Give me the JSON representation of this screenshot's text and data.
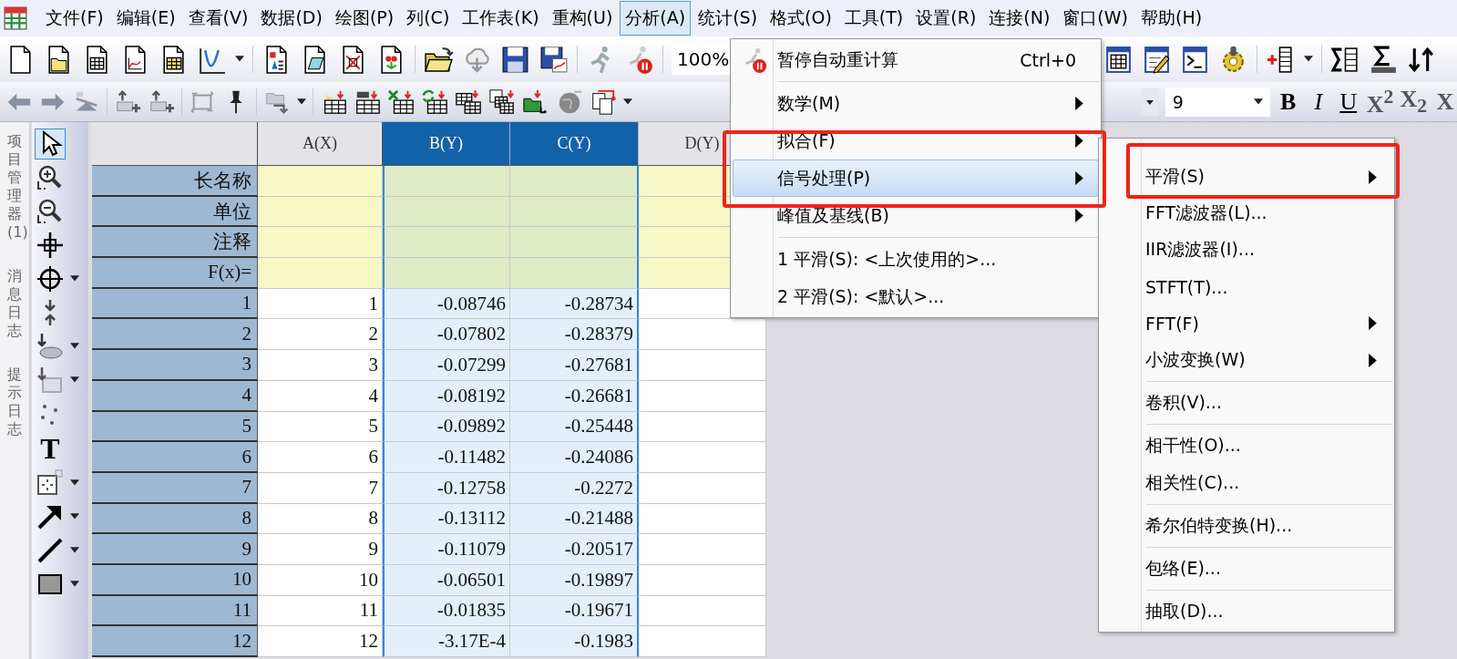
{
  "menu_bar": [
    {
      "label": "文件(F)",
      "selected": false
    },
    {
      "label": "编辑(E)",
      "selected": false
    },
    {
      "label": "查看(V)",
      "selected": false
    },
    {
      "label": "数据(D)",
      "selected": false
    },
    {
      "label": "绘图(P)",
      "selected": false
    },
    {
      "label": "列(C)",
      "selected": false
    },
    {
      "label": "工作表(K)",
      "selected": false
    },
    {
      "label": "重构(U)",
      "selected": false
    },
    {
      "label": "分析(A)",
      "selected": true
    },
    {
      "label": "统计(S)",
      "selected": false
    },
    {
      "label": "格式(O)",
      "selected": false
    },
    {
      "label": "工具(T)",
      "selected": false
    },
    {
      "label": "设置(R)",
      "selected": false
    },
    {
      "label": "连接(N)",
      "selected": false
    },
    {
      "label": "窗口(W)",
      "selected": false
    },
    {
      "label": "帮助(H)",
      "selected": false
    }
  ],
  "zoom_field": {
    "value": "100%"
  },
  "font_size_field": {
    "value": "9"
  },
  "format_buttons": [
    {
      "label": "B",
      "kind": "bold"
    },
    {
      "label": "I",
      "kind": "italic"
    },
    {
      "label": "U",
      "kind": "underline"
    },
    {
      "label": "X$^{2}$",
      "kind": "script"
    },
    {
      "label": "X$_{2}$",
      "kind": "script"
    },
    {
      "label": "X",
      "kind": "script"
    }
  ],
  "side_tabs": [
    "项目管理器(1)",
    "消息日志",
    "提示日志"
  ],
  "toolbox": {
    "pointer": {
      "selected": true
    },
    "text_tool": {
      "label": "T",
      "selected": false
    }
  },
  "worksheet": {
    "columns": [
      {
        "label": "A(X)",
        "selected": false
      },
      {
        "label": "B(Y)",
        "selected": true
      },
      {
        "label": "C(Y)",
        "selected": true
      },
      {
        "label": "D(Y)",
        "selected": false
      }
    ],
    "label_rows": [
      "长名称",
      "单位",
      "注释",
      "F(x)="
    ],
    "rows": [
      {
        "index": "1",
        "cells": [
          "1",
          "-0.08746",
          "-0.28734"
        ]
      },
      {
        "index": "2",
        "cells": [
          "2",
          "-0.07802",
          "-0.28379"
        ]
      },
      {
        "index": "3",
        "cells": [
          "3",
          "-0.07299",
          "-0.27681"
        ]
      },
      {
        "index": "4",
        "cells": [
          "4",
          "-0.08192",
          "-0.26681"
        ]
      },
      {
        "index": "5",
        "cells": [
          "5",
          "-0.09892",
          "-0.25448"
        ]
      },
      {
        "index": "6",
        "cells": [
          "6",
          "-0.11482",
          "-0.24086"
        ]
      },
      {
        "index": "7",
        "cells": [
          "7",
          "-0.12758",
          "-0.2272"
        ]
      },
      {
        "index": "8",
        "cells": [
          "8",
          "-0.13112",
          "-0.21488"
        ]
      },
      {
        "index": "9",
        "cells": [
          "9",
          "-0.11079",
          "-0.20517"
        ]
      },
      {
        "index": "10",
        "cells": [
          "10",
          "-0.06501",
          "-0.19897"
        ]
      },
      {
        "index": "11",
        "cells": [
          "11",
          "-0.01835",
          "-0.19671"
        ]
      },
      {
        "index": "12",
        "cells": [
          "12",
          "-3.17E-4",
          "-0.1983"
        ]
      }
    ]
  },
  "analysis_menu": {
    "items": [
      {
        "kind": "icon_command",
        "label": "暂停自动重计算",
        "shortcut": "Ctrl+0",
        "selected": false
      },
      {
        "kind": "separator"
      },
      {
        "kind": "submenu",
        "label": "数学(M)",
        "selected": false
      },
      {
        "kind": "submenu",
        "label": "拟合(F)",
        "selected": false
      },
      {
        "kind": "submenu",
        "label": "信号处理(P)",
        "selected": true
      },
      {
        "kind": "submenu",
        "label": "峰值及基线(B)",
        "selected": false
      },
      {
        "kind": "separator"
      },
      {
        "kind": "command",
        "label": "1 平滑(S): <上次使用的>...",
        "selected": false
      },
      {
        "kind": "command",
        "label": "2 平滑(S): <默认>...",
        "selected": false
      }
    ]
  },
  "signal_submenu": {
    "items": [
      {
        "kind": "submenu",
        "label": "平滑(S)",
        "selected": false
      },
      {
        "kind": "command",
        "label": "FFT滤波器(L)...",
        "selected": false
      },
      {
        "kind": "command",
        "label": "IIR滤波器(I)...",
        "selected": false
      },
      {
        "kind": "command",
        "label": "STFT(T)...",
        "selected": false
      },
      {
        "kind": "submenu",
        "label": "FFT(F)",
        "selected": false
      },
      {
        "kind": "submenu",
        "label": "小波变换(W)",
        "selected": false
      },
      {
        "kind": "separator"
      },
      {
        "kind": "command",
        "label": "卷积(V)...",
        "selected": false
      },
      {
        "kind": "separator"
      },
      {
        "kind": "command",
        "label": "相干性(O)...",
        "selected": false
      },
      {
        "kind": "command",
        "label": "相关性(C)...",
        "selected": false
      },
      {
        "kind": "separator"
      },
      {
        "kind": "command",
        "label": "希尔伯特变换(H)...",
        "selected": false
      },
      {
        "kind": "separator"
      },
      {
        "kind": "command",
        "label": "包络(E)...",
        "selected": false
      },
      {
        "kind": "separator"
      },
      {
        "kind": "command",
        "label": "抽取(D)...",
        "selected": false
      }
    ]
  }
}
